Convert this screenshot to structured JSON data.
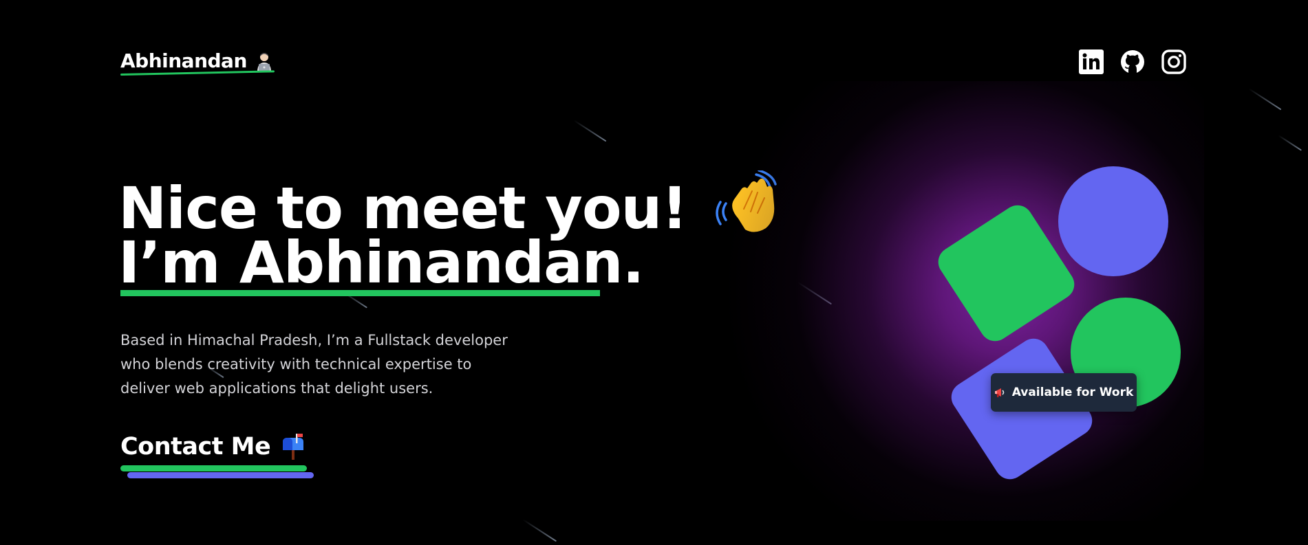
{
  "header": {
    "logo_text": "Abhinandan",
    "logo_emoji": "👨🏻‍💻",
    "social_links": [
      {
        "name": "linkedin-icon"
      },
      {
        "name": "github-icon"
      },
      {
        "name": "instagram-icon"
      }
    ]
  },
  "hero": {
    "greeting": "Nice to meet you!",
    "greeting_emoji": "👋",
    "name_line": "I’m Abhinandan.",
    "description_lines": [
      "Based in Himachal Pradesh, I’m a Fullstack developer",
      "who blends creativity with technical expertise to",
      "deliver web applications that delight users."
    ],
    "contact_label": "Contact Me",
    "contact_emoji": "📫"
  },
  "artwork": {
    "badge_emoji": "📢",
    "badge_text": "Available for Work"
  },
  "colors": {
    "background": "#000000",
    "accent_green": "#22c55e",
    "accent_blue": "#6366f1",
    "glow_purple": "#7e22a2",
    "badge_bg": "#1e293b"
  }
}
